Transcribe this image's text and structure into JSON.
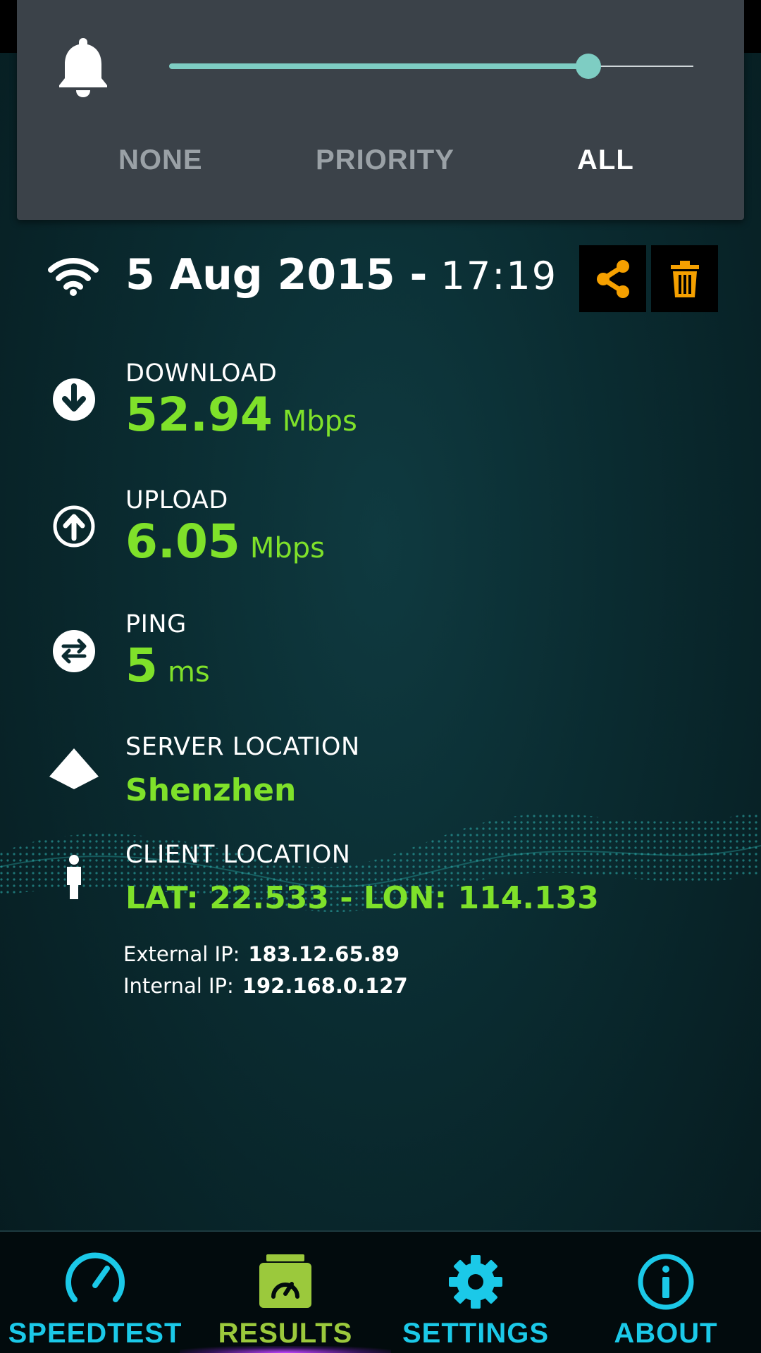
{
  "volume_panel": {
    "level": 0.8,
    "modes": [
      {
        "label": "NONE",
        "active": false
      },
      {
        "label": "PRIORITY",
        "active": false
      },
      {
        "label": "ALL",
        "active": true
      }
    ],
    "accent": "#7ecdc3"
  },
  "result": {
    "date": "5 Aug 2015 -",
    "time": "17:19",
    "actions": {
      "share_icon": "share-icon",
      "delete_icon": "trash-icon",
      "color": "#f5a000"
    }
  },
  "metrics": {
    "download": {
      "label": "DOWNLOAD",
      "value": "52.94",
      "unit": "Mbps"
    },
    "upload": {
      "label": "UPLOAD",
      "value": "6.05",
      "unit": "Mbps"
    },
    "ping": {
      "label": "PING",
      "value": "5",
      "unit": "ms"
    }
  },
  "server": {
    "label": "SERVER LOCATION",
    "value": "Shenzhen"
  },
  "client": {
    "label": "CLIENT LOCATION",
    "value": "LAT: 22.533 - LON: 114.133"
  },
  "ip": {
    "external_label": "External IP:",
    "external_value": "183.12.65.89",
    "internal_label": "Internal IP:",
    "internal_value": "192.168.0.127"
  },
  "nav": {
    "speedtest": "SPEEDTEST",
    "results": "RESULTS",
    "settings": "SETTINGS",
    "about": "ABOUT",
    "active": "results",
    "accent": "#1bc9e8",
    "active_color": "#9bc93c"
  },
  "value_color": "#7fe12a"
}
